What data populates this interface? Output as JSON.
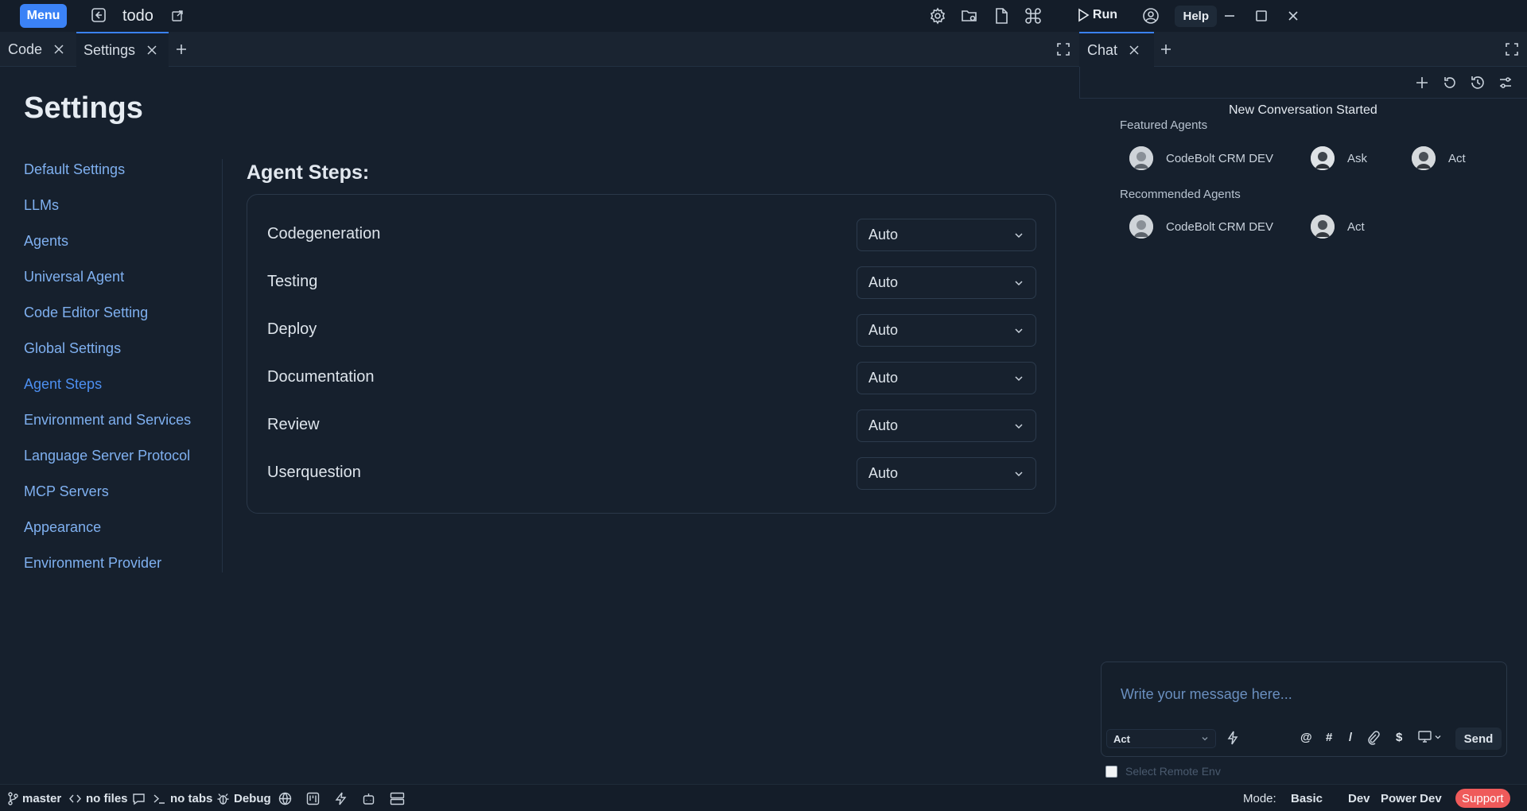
{
  "titlebar": {
    "menu_label": "Menu",
    "project_title": "todo",
    "run_label": "Run",
    "help_label": "Help",
    "icons": [
      "settings-icon",
      "folder-gear-icon",
      "file-icon",
      "command-icon",
      "play-icon",
      "account-icon",
      "minimize-icon",
      "maximize-icon",
      "close-icon"
    ]
  },
  "editor_tabs": [
    {
      "label": "Code",
      "active": false
    },
    {
      "label": "Settings",
      "active": true
    }
  ],
  "chat_tabs": [
    {
      "label": "Chat",
      "active": true
    }
  ],
  "settings": {
    "title": "Settings",
    "nav": [
      {
        "label": "Default Settings"
      },
      {
        "label": "LLMs"
      },
      {
        "label": "Agents"
      },
      {
        "label": "Universal Agent"
      },
      {
        "label": "Code Editor Setting"
      },
      {
        "label": "Global Settings"
      },
      {
        "label": "Agent Steps",
        "active": true
      },
      {
        "label": "Environment and Services"
      },
      {
        "label": "Language Server Protocol"
      },
      {
        "label": "MCP Servers"
      },
      {
        "label": "Appearance"
      },
      {
        "label": "Environment Provider"
      }
    ],
    "section_title": "Agent Steps:",
    "steps": [
      {
        "label": "Codegeneration",
        "value": "Auto"
      },
      {
        "label": "Testing",
        "value": "Auto"
      },
      {
        "label": "Deploy",
        "value": "Auto"
      },
      {
        "label": "Documentation",
        "value": "Auto"
      },
      {
        "label": "Review",
        "value": "Auto"
      },
      {
        "label": "Userquestion",
        "value": "Auto"
      }
    ]
  },
  "chat": {
    "conversation_status": "New Conversation Started",
    "featured_heading": "Featured Agents",
    "featured_agents": [
      {
        "name": "CodeBolt CRM DEV"
      },
      {
        "name": "Ask"
      },
      {
        "name": "Act"
      }
    ],
    "recommended_heading": "Recommended Agents",
    "recommended_agents": [
      {
        "name": "CodeBolt CRM DEV"
      },
      {
        "name": "Act"
      }
    ],
    "input_placeholder": "Write your message here...",
    "mode_value": "Act",
    "shortcuts": [
      "@",
      "#",
      "/",
      "$"
    ],
    "send_label": "Send",
    "remote_env_label": "Select Remote Env"
  },
  "statusbar": {
    "branch": "master",
    "files": "no files",
    "tabs": "no tabs",
    "debug": "Debug",
    "mode_label": "Mode:",
    "modes": [
      "Basic",
      "Dev",
      "Power Dev"
    ],
    "support": "Support"
  },
  "colors": {
    "accent": "#3b82f6",
    "background": "#16202d",
    "support": "#ef5a5a"
  }
}
